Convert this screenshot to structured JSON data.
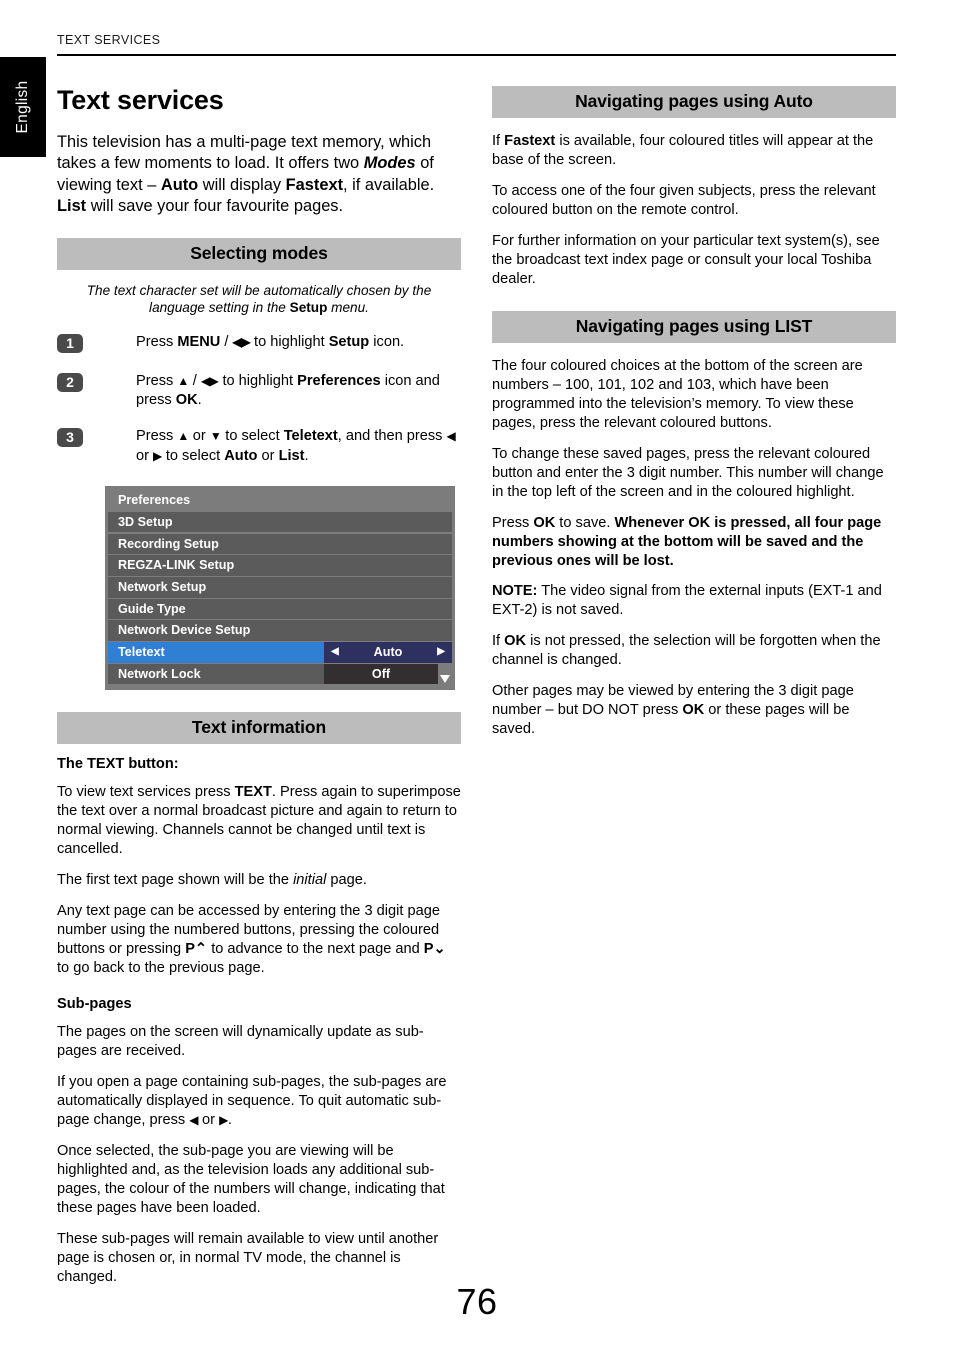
{
  "header": {
    "running_head": "TEXT SERVICES",
    "language_tab": "English"
  },
  "page_number": "76",
  "left_column": {
    "title": "Text services",
    "intro_parts": {
      "p1": "This television has a multi-page text memory, which takes a few moments to load. It offers two ",
      "modes": "Modes",
      "p2": " of viewing text – ",
      "auto": "Auto",
      "p3": " will display ",
      "fastext": "Fastext",
      "p4": ", if available. ",
      "list": "List",
      "p5": " will save your four favourite pages."
    },
    "selecting_modes": {
      "bar_label": "Selecting modes",
      "caption_p1": "The text character set will be automatically chosen by the language setting in the ",
      "caption_setup": "Setup",
      "caption_p2": " menu.",
      "steps": [
        {
          "number": "1",
          "t1": "Press ",
          "b1": "MENU",
          "t2": " / ",
          "arrows": "◀▶",
          "t3": " to highlight ",
          "b2": "Setup",
          "t4": " icon."
        },
        {
          "number": "2",
          "t1": "Press ",
          "arrow_up": "▲",
          "t2": " / ",
          "arrows": "◀▶",
          "t3": " to highlight ",
          "b2": "Preferences",
          "t4": " icon and press ",
          "b3": "OK",
          "t5": "."
        },
        {
          "number": "3",
          "t1": "Press ",
          "arrow_up": "▲",
          "t2": " or ",
          "arrow_down": "▼",
          "t3": " to select ",
          "b2": "Teletext",
          "t4": ", and then press ",
          "arrow_left": "◀",
          "t5": " or ",
          "arrow_right": "▶",
          "t6": " to select ",
          "b3": "Auto",
          "t7": " or ",
          "b4": "List",
          "t8": "."
        }
      ]
    },
    "tv_menu": {
      "title": "Preferences",
      "rows": [
        {
          "label": "3D Setup",
          "value": "",
          "selected": false
        },
        {
          "label": "Recording Setup",
          "value": "",
          "selected": false
        },
        {
          "label": "REGZA-LINK Setup",
          "value": "",
          "selected": false
        },
        {
          "label": "Network Setup",
          "value": "",
          "selected": false
        },
        {
          "label": "Guide Type",
          "value": "",
          "selected": false
        },
        {
          "label": "Network Device Setup",
          "value": "",
          "selected": false
        },
        {
          "label": "Teletext",
          "value": "Auto",
          "selected": true
        },
        {
          "label": "Network Lock",
          "value": "Off",
          "selected": false
        }
      ],
      "left_caret": "◀",
      "right_caret": "▶",
      "colors": {
        "panel_bg": "#7c7c7c",
        "row_bg": "#5b5b5b",
        "selected_label_bg": "#2f7fd4",
        "selected_value_bg": "#2e3060",
        "value_bg": "#332f31",
        "text": "#ffffff"
      }
    },
    "text_information": {
      "bar_label": "Text information",
      "subhead_text_button": "The TEXT button:",
      "para_text_button": {
        "t1": "To view text services press ",
        "b1": "TEXT",
        "t2": ". Press again to superimpose the text over a normal broadcast picture and again to return to normal viewing. Channels cannot be changed until text is cancelled."
      },
      "para_initial": {
        "t1": "The first text page shown will be the ",
        "i1": "initial",
        "t2": " page."
      },
      "para_any_page": {
        "t1": "Any text page can be accessed by entering the 3 digit page number using the numbered buttons, pressing the coloured buttons or pressing ",
        "b1": "P⌃",
        "t2": " to advance to the next page and ",
        "b2": "P⌄",
        "t3": " to go back to the previous page."
      },
      "subhead_subpages": "Sub-pages",
      "para_subpages_1": "The pages on the screen will dynamically update as sub-pages are received.",
      "para_subpages_2": {
        "t1": "If you open a page containing sub-pages, the sub-pages are automatically displayed in sequence. To quit automatic sub-page change, press ",
        "a1": "◀",
        "t2": " or ",
        "a2": "▶",
        "t3": "."
      },
      "para_subpages_3": "Once selected, the sub-page you are viewing will be highlighted and, as the television loads any additional sub-pages, the colour of the numbers will change, indicating that these pages have been loaded.",
      "para_subpages_4": "These sub-pages will remain available to view until another page is chosen or, in normal TV mode, the channel is changed."
    }
  },
  "right_column": {
    "nav_auto": {
      "bar_label": "Navigating pages using Auto",
      "para_1": {
        "t1": "If ",
        "b1": "Fastext",
        "t2": " is available, four coloured titles will appear at the base of the screen."
      },
      "para_2": "To access one of the four given subjects, press the relevant coloured button on the remote control.",
      "para_3": "For further information on your particular text system(s), see the broadcast text index page or consult your local Toshiba dealer."
    },
    "nav_list": {
      "bar_label": "Navigating pages using LIST",
      "para_1": "The four coloured choices at the bottom of the screen are numbers – 100, 101, 102 and 103, which have been programmed into the television’s memory. To view these pages, press the relevant coloured buttons.",
      "para_2": "To change these saved pages, press the relevant coloured button and enter the 3 digit number. This number will change in the top left of the screen and in the coloured highlight.",
      "para_3": {
        "t1": "Press ",
        "b1": "OK",
        "t2": " to save. ",
        "b2": "Whenever OK is pressed, all four page numbers showing at the bottom will be saved and the previous ones will be lost."
      },
      "para_4": {
        "b1": "NOTE:",
        "t1": " The video signal from the external inputs (EXT-1 and EXT-2) is not saved."
      },
      "para_5": {
        "t1": "If ",
        "b1": "OK",
        "t2": " is not pressed, the selection will be forgotten when the channel is changed."
      },
      "para_6": {
        "t1": "Other pages may be viewed by entering the 3 digit page number – but DO NOT press ",
        "b1": "OK",
        "t2": " or these pages will be saved."
      }
    }
  }
}
